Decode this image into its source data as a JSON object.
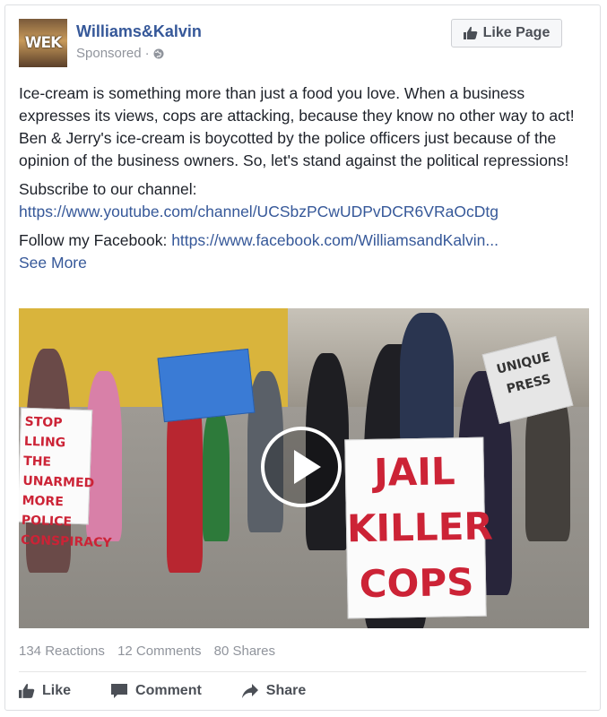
{
  "post": {
    "page_name": "Williams&Kalvin",
    "sponsored_label": "Sponsored",
    "sponsored_separator": "·",
    "avatar_text": "WEK",
    "like_page_label": "Like Page",
    "body_paragraph": "Ice-cream is something more than just a food you love. When a business expresses its views, cops are attacking, because they know no other way to act! Ben & Jerry's ice-cream is boycotted by the police officers just because of the opinion of the business owners. So, let's stand against the political repressions!",
    "subscribe_label": "Subscribe to our channel:",
    "youtube_link": "https://www.youtube.com/channel/UCSbzPCwUDPvDCR6VRaOcDtg",
    "follow_label": "Follow my Facebook: ",
    "facebook_link": "https://www.facebook.com/WilliamsandKalvin...",
    "see_more": "See More"
  },
  "media": {
    "type": "video",
    "signs": {
      "jail_killer_cops": "JAIL KILLER COPS",
      "stop_killing": "STOP LLING THE UNARMED MORE POLICE CONSPIRACY",
      "unique_press": "UNIQUE PRESS"
    }
  },
  "stats": {
    "reactions": "134 Reactions",
    "comments": "12 Comments",
    "shares": "80 Shares"
  },
  "actions": {
    "like": "Like",
    "comment": "Comment",
    "share": "Share"
  },
  "colors": {
    "link": "#365899",
    "muted": "#90949c",
    "action_text": "#4b4f56"
  },
  "icons": [
    "like-thumb-icon",
    "globe-icon",
    "comment-icon",
    "share-arrow-icon",
    "play-icon"
  ]
}
